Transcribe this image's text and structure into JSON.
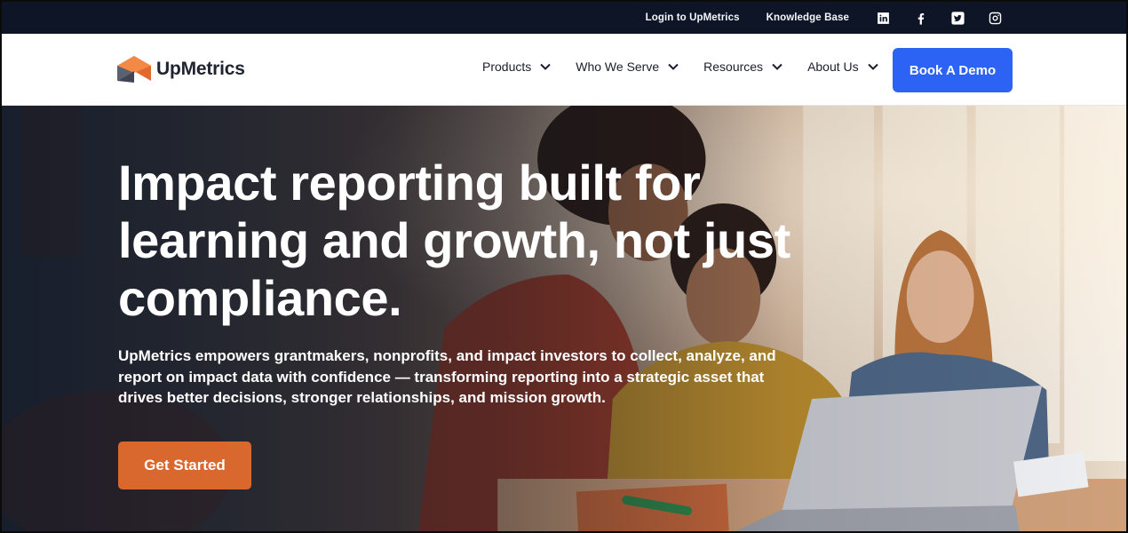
{
  "topbar": {
    "login_label": "Login to UpMetrics",
    "knowledge_label": "Knowledge Base",
    "social_icons": [
      "linkedin-icon",
      "facebook-icon",
      "twitter-icon",
      "instagram-icon"
    ]
  },
  "header": {
    "brand": "UpMetrics",
    "nav": [
      {
        "label": "Products"
      },
      {
        "label": "Who We Serve"
      },
      {
        "label": "Resources"
      },
      {
        "label": "About Us"
      }
    ],
    "demo_label": "Book A Demo"
  },
  "hero": {
    "title": "Impact reporting built for learning and growth, not just compliance.",
    "subtitle": "UpMetrics empowers grantmakers, nonprofits, and impact investors to collect, analyze, and report on impact data with confidence — transforming reporting into a strategic asset that drives better decisions, stronger relationships, and mission growth.",
    "cta_label": "Get Started"
  },
  "colors": {
    "topbar_bg": "#0d1526",
    "demo_button": "#2c63f4",
    "cta_button": "#d9682f",
    "brand_orange": "#e2692d",
    "brand_gray": "#5a6270"
  }
}
